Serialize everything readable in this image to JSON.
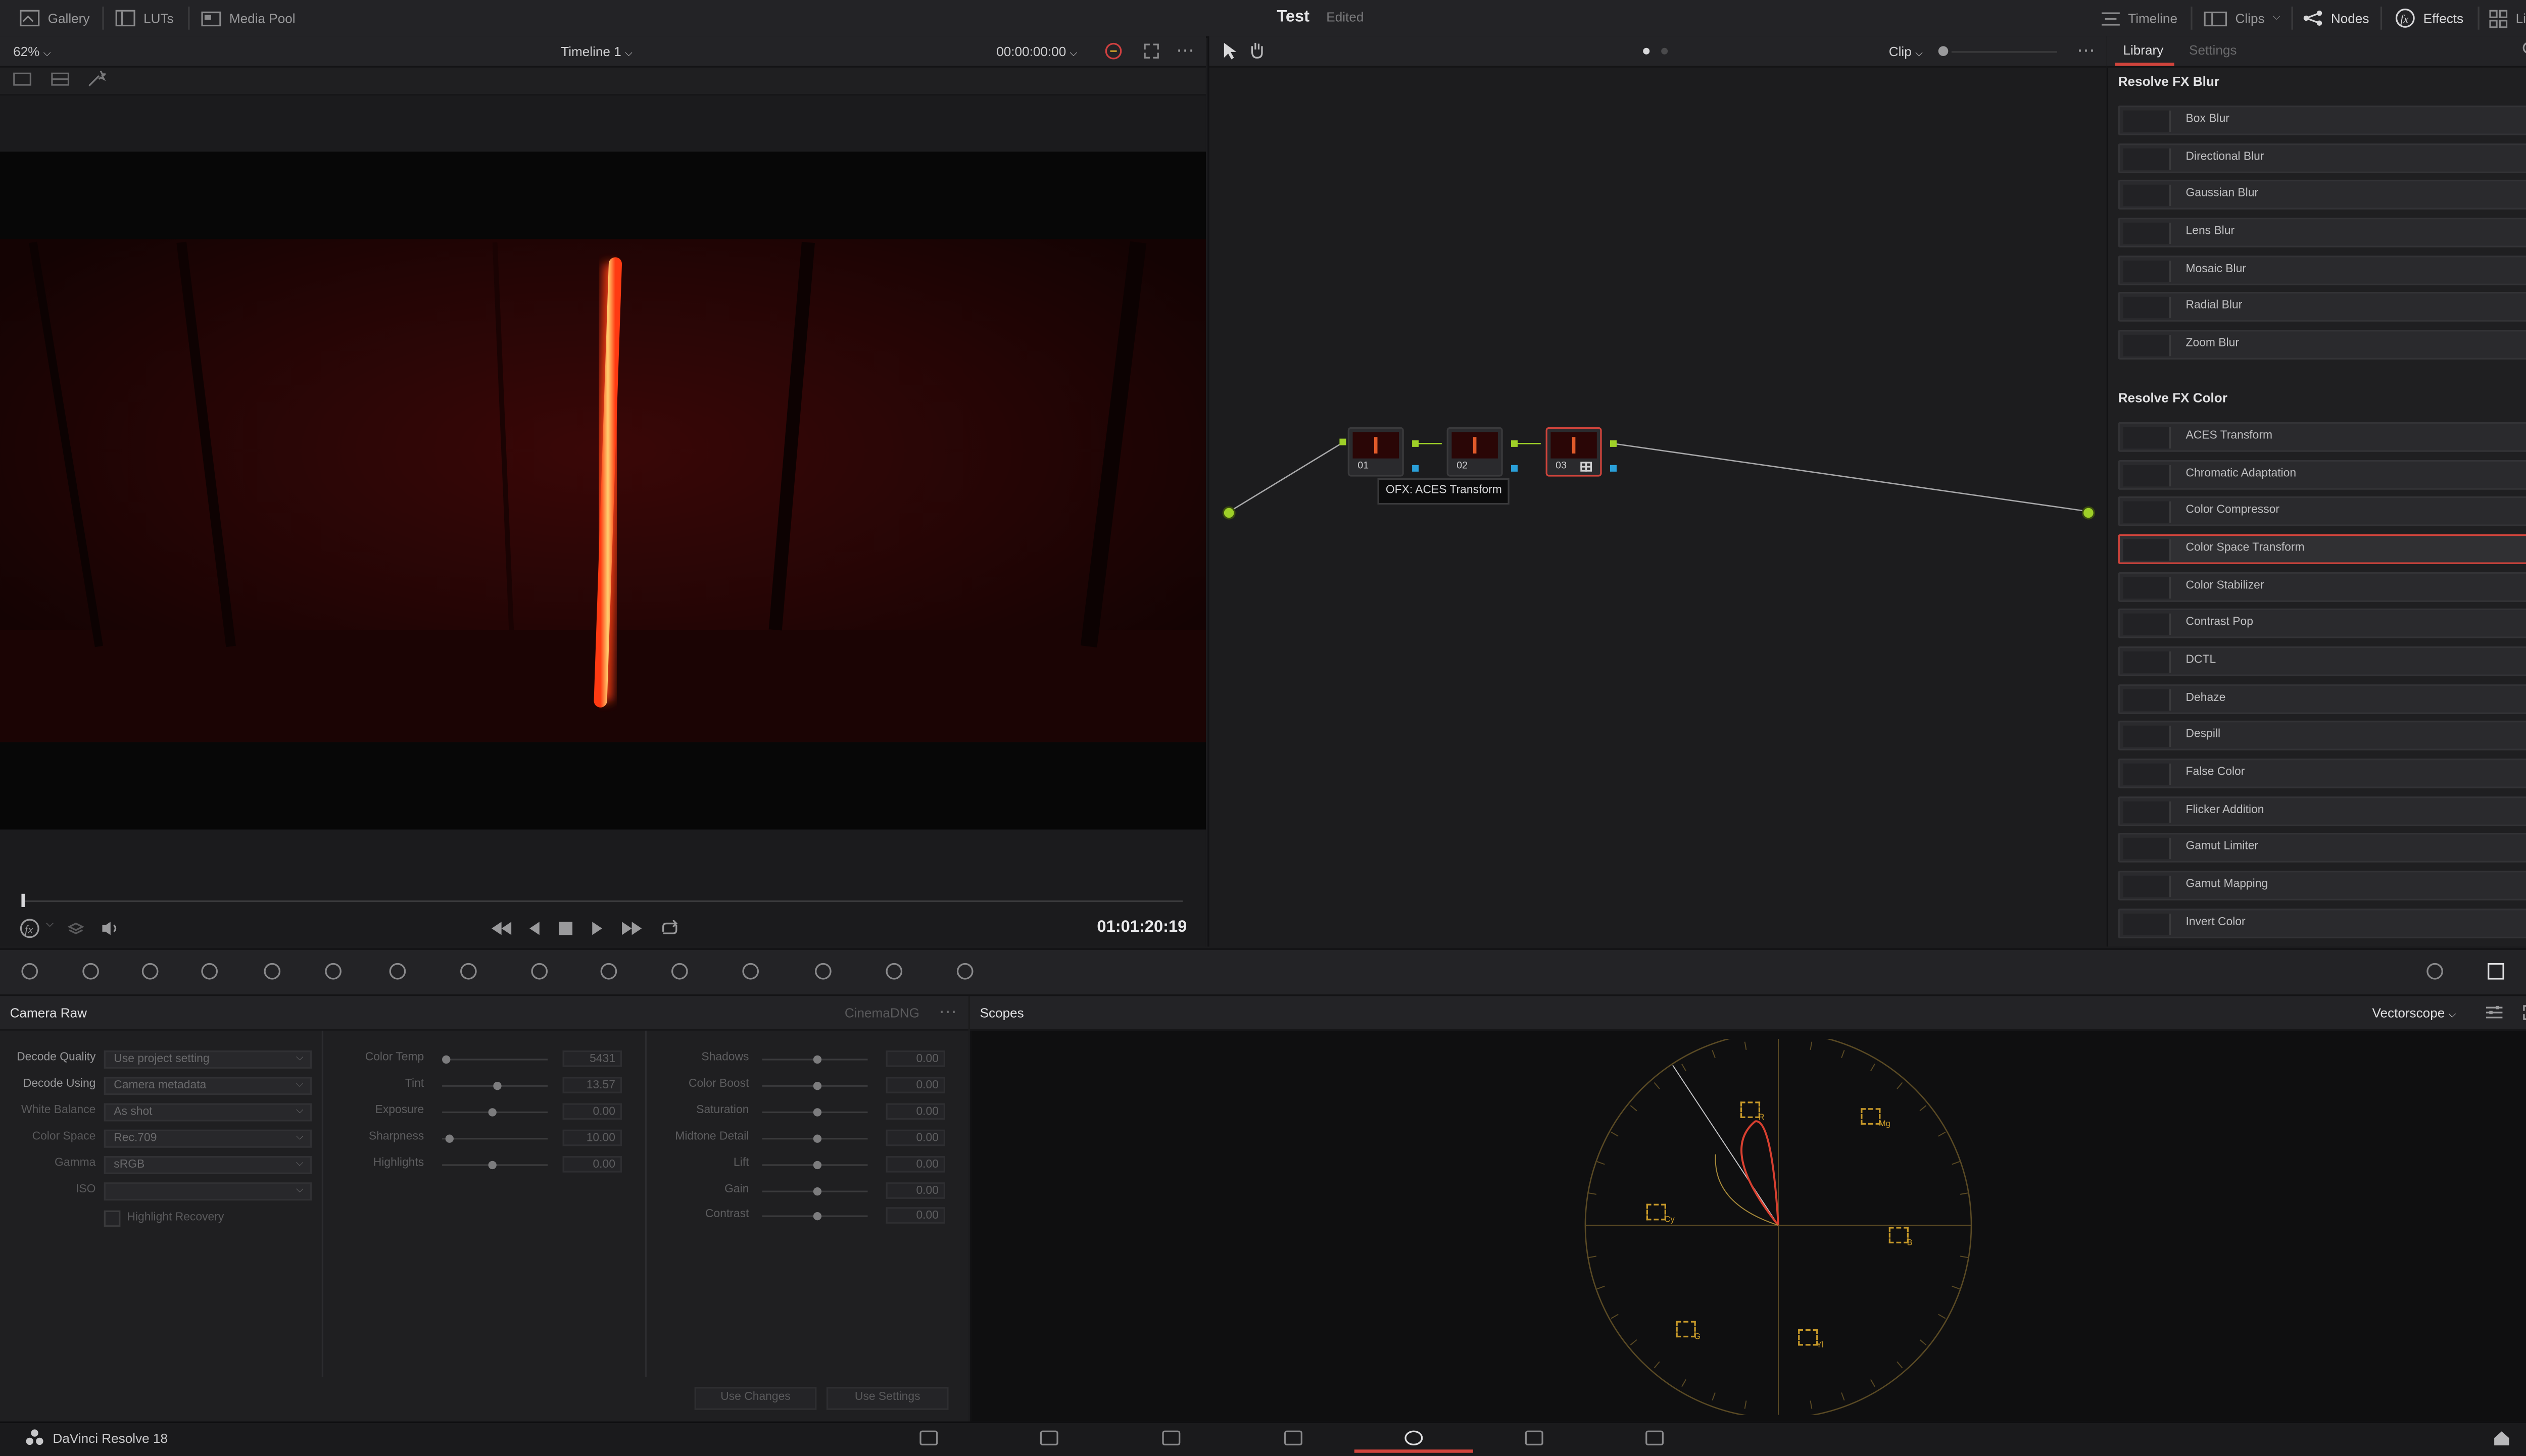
{
  "app": {
    "title": "Test",
    "status": "Edited",
    "name": "DaVinci Resolve 18"
  },
  "topbar": {
    "left": [
      {
        "label": "Gallery",
        "icon": "gallery-icon"
      },
      {
        "label": "LUTs",
        "icon": "luts-icon"
      },
      {
        "label": "Media Pool",
        "icon": "media-pool-icon"
      }
    ],
    "right": [
      {
        "label": "Timeline",
        "icon": "timeline-icon"
      },
      {
        "label": "Clips",
        "icon": "clips-icon"
      },
      {
        "label": "Nodes",
        "icon": "nodes-icon"
      },
      {
        "label": "Effects",
        "icon": "effects-icon"
      },
      {
        "label": "Lightbox",
        "icon": "lightbox-icon"
      }
    ]
  },
  "viewer": {
    "zoom": "62%",
    "timeline": "Timeline 1",
    "timecode": "00:00:00:00",
    "clip_timecode": "01:01:20:19"
  },
  "nodes": {
    "mode": "Clip",
    "items": [
      {
        "num": "01"
      },
      {
        "num": "02"
      },
      {
        "num": "03"
      }
    ],
    "tooltip": "OFX: ACES Transform"
  },
  "effects": {
    "tabs": [
      "Library",
      "Settings"
    ],
    "sections": [
      {
        "title": "Resolve FX Blur",
        "items": [
          "Box Blur",
          "Directional Blur",
          "Gaussian Blur",
          "Lens Blur",
          "Mosaic Blur",
          "Radial Blur",
          "Zoom Blur"
        ]
      },
      {
        "title": "Resolve FX Color",
        "items": [
          "ACES Transform",
          "Chromatic Adaptation",
          "Color Compressor",
          "Color Space Transform",
          "Color Stabilizer",
          "Contrast Pop",
          "DCTL",
          "Dehaze",
          "Despill",
          "False Color",
          "Flicker Addition",
          "Gamut Limiter",
          "Gamut Mapping",
          "Invert Color"
        ]
      }
    ],
    "selected": "Color Space Transform"
  },
  "camera_raw": {
    "title": "Camera Raw",
    "format": "CinemaDNG",
    "fields": [
      {
        "label": "Decode Quality",
        "value": "Use project setting"
      },
      {
        "label": "Decode Using",
        "value": "Camera metadata"
      },
      {
        "label": "White Balance",
        "value": "As shot"
      },
      {
        "label": "Color Space",
        "value": "Rec.709"
      },
      {
        "label": "Gamma",
        "value": "sRGB"
      },
      {
        "label": "ISO",
        "value": ""
      }
    ],
    "highlight_recovery": "Highlight Recovery",
    "sliders_a": [
      {
        "label": "Color Temp",
        "value": "5431",
        "level": 0.0
      },
      {
        "label": "Tint",
        "value": "13.57",
        "level": 0.5
      },
      {
        "label": "Exposure",
        "value": "0.00",
        "level": 0.45
      },
      {
        "label": "Sharpness",
        "value": "10.00",
        "level": 0.03
      },
      {
        "label": "Highlights",
        "value": "0.00",
        "level": 0.45
      }
    ],
    "sliders_b": [
      {
        "label": "Shadows",
        "value": "0.00",
        "level": 0.5
      },
      {
        "label": "Color Boost",
        "value": "0.00",
        "level": 0.5
      },
      {
        "label": "Saturation",
        "value": "0.00",
        "level": 0.5
      },
      {
        "label": "Midtone Detail",
        "value": "0.00",
        "level": 0.5
      },
      {
        "label": "Lift",
        "value": "0.00",
        "level": 0.5
      },
      {
        "label": "Gain",
        "value": "0.00",
        "level": 0.5
      },
      {
        "label": "Contrast",
        "value": "0.00",
        "level": 0.5
      }
    ],
    "use_changes": "Use Changes",
    "use_settings": "Use Settings"
  },
  "scopes": {
    "title": "Scopes",
    "mode": "Vectorscope",
    "targets": [
      "R",
      "Mg",
      "B",
      "Cy",
      "G",
      "Yl"
    ]
  },
  "pages": [
    "media-page-icon",
    "cut-page-icon",
    "edit-page-icon",
    "fusion-page-icon",
    "color-page-icon",
    "fairlight-page-icon",
    "deliver-page-icon"
  ],
  "colors": {
    "accent": "#d0443c",
    "node_green": "#9ecf28",
    "node_blue": "#2a9fd8"
  }
}
